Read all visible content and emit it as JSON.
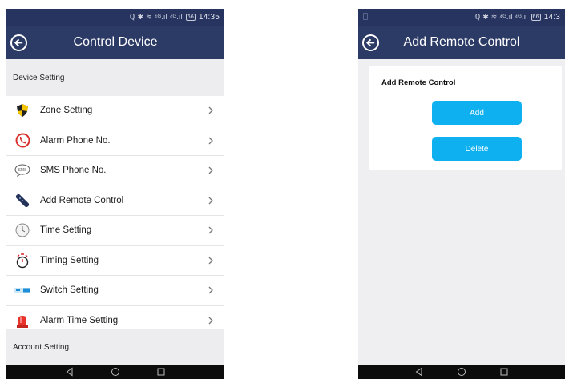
{
  "left_screen": {
    "status": {
      "icons": "ℚ ✱ ≋ ⁴ᴳ.ıl ⁴ᴳ.ıl",
      "battery": "66",
      "time": "14:35"
    },
    "title": "Control Device",
    "device_section": "Device Setting",
    "items": [
      {
        "label": "Zone Setting",
        "icon": "zone-shield-icon"
      },
      {
        "label": "Alarm Phone No.",
        "icon": "phone-icon"
      },
      {
        "label": "SMS Phone No.",
        "icon": "sms-icon"
      },
      {
        "label": "Add Remote Control",
        "icon": "remote-control-icon"
      },
      {
        "label": "Time Setting",
        "icon": "clock-icon"
      },
      {
        "label": "Timing Setting",
        "icon": "stopwatch-icon"
      },
      {
        "label": "Switch Setting",
        "icon": "switch-icon"
      },
      {
        "label": "Alarm Time Setting",
        "icon": "siren-icon"
      }
    ],
    "account_section": "Account Setting"
  },
  "right_screen": {
    "status": {
      "icons": "ℚ ✱ ≋ ⁴ᴳ.ıl ⁴ᴳ.ıl",
      "battery": "66",
      "time": "14:3"
    },
    "title": "Add Remote Control",
    "card_title": "Add Remote Control",
    "add_label": "Add",
    "delete_label": "Delete"
  },
  "colors": {
    "header": "#2c3a66",
    "status_bar": "#283460",
    "button": "#0fb0ef",
    "section_bg": "#ededef"
  }
}
